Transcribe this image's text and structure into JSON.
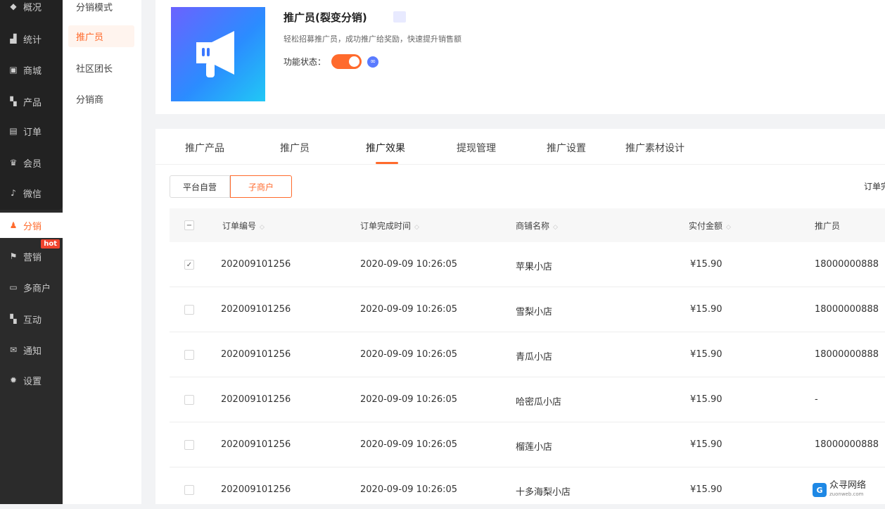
{
  "nav": {
    "items": [
      {
        "label": "概况",
        "icon": "layers-icon"
      },
      {
        "label": "统计",
        "icon": "chart-icon"
      },
      {
        "label": "商城",
        "icon": "store-icon"
      },
      {
        "label": "产品",
        "icon": "grid-icon"
      },
      {
        "label": "订单",
        "icon": "order-icon"
      },
      {
        "label": "会员",
        "icon": "crown-icon"
      },
      {
        "label": "微信",
        "icon": "wechat-icon"
      },
      {
        "label": "分销",
        "icon": "people-icon"
      },
      {
        "label": "营销",
        "icon": "flag-icon",
        "badge": "hot"
      },
      {
        "label": "多商户",
        "icon": "shop-icon"
      },
      {
        "label": "互动",
        "icon": "apps-icon"
      },
      {
        "label": "通知",
        "icon": "mail-icon"
      },
      {
        "label": "设置",
        "icon": "gear-icon"
      }
    ],
    "active": "分销"
  },
  "subnav": {
    "items": [
      "分销模式",
      "推广员",
      "社区团长",
      "分销商"
    ],
    "active": "推广员"
  },
  "hero": {
    "title": "推广员(裂变分销)",
    "desc": "轻松招募推广员，成功推广给奖励，快速提升销售额",
    "status_label": "功能状态：",
    "toggle_on": true
  },
  "tabs": [
    "推广产品",
    "推广员",
    "推广效果",
    "提现管理",
    "推广设置",
    "推广素材设计"
  ],
  "active_tab": "推广效果",
  "segments": [
    "平台自营",
    "子商户"
  ],
  "active_segment": "子商户",
  "right_label": "订单完",
  "table": {
    "columns": [
      "订单编号",
      "订单完成时间",
      "商铺名称",
      "实付金额",
      "推广员"
    ],
    "rows": [
      {
        "checked": true,
        "order_no": "202009101256",
        "time": "2020-09-09 10:26:05",
        "shop": "苹果小店",
        "amount": "¥15.90",
        "promoter": "18000000888"
      },
      {
        "checked": false,
        "order_no": "202009101256",
        "time": "2020-09-09 10:26:05",
        "shop": "雪梨小店",
        "amount": "¥15.90",
        "promoter": "18000000888"
      },
      {
        "checked": false,
        "order_no": "202009101256",
        "time": "2020-09-09 10:26:05",
        "shop": "青瓜小店",
        "amount": "¥15.90",
        "promoter": "18000000888"
      },
      {
        "checked": false,
        "order_no": "202009101256",
        "time": "2020-09-09 10:26:05",
        "shop": "哈密瓜小店",
        "amount": "¥15.90",
        "promoter": "-"
      },
      {
        "checked": false,
        "order_no": "202009101256",
        "time": "2020-09-09 10:26:05",
        "shop": "榴莲小店",
        "amount": "¥15.90",
        "promoter": "18000000888"
      },
      {
        "checked": false,
        "order_no": "202009101256",
        "time": "2020-09-09 10:26:05",
        "shop": "十多海梨小店",
        "amount": "¥15.90",
        "promoter": ""
      }
    ]
  },
  "watermark": {
    "name": "众寻网络",
    "sub": "zuonweb.com"
  }
}
